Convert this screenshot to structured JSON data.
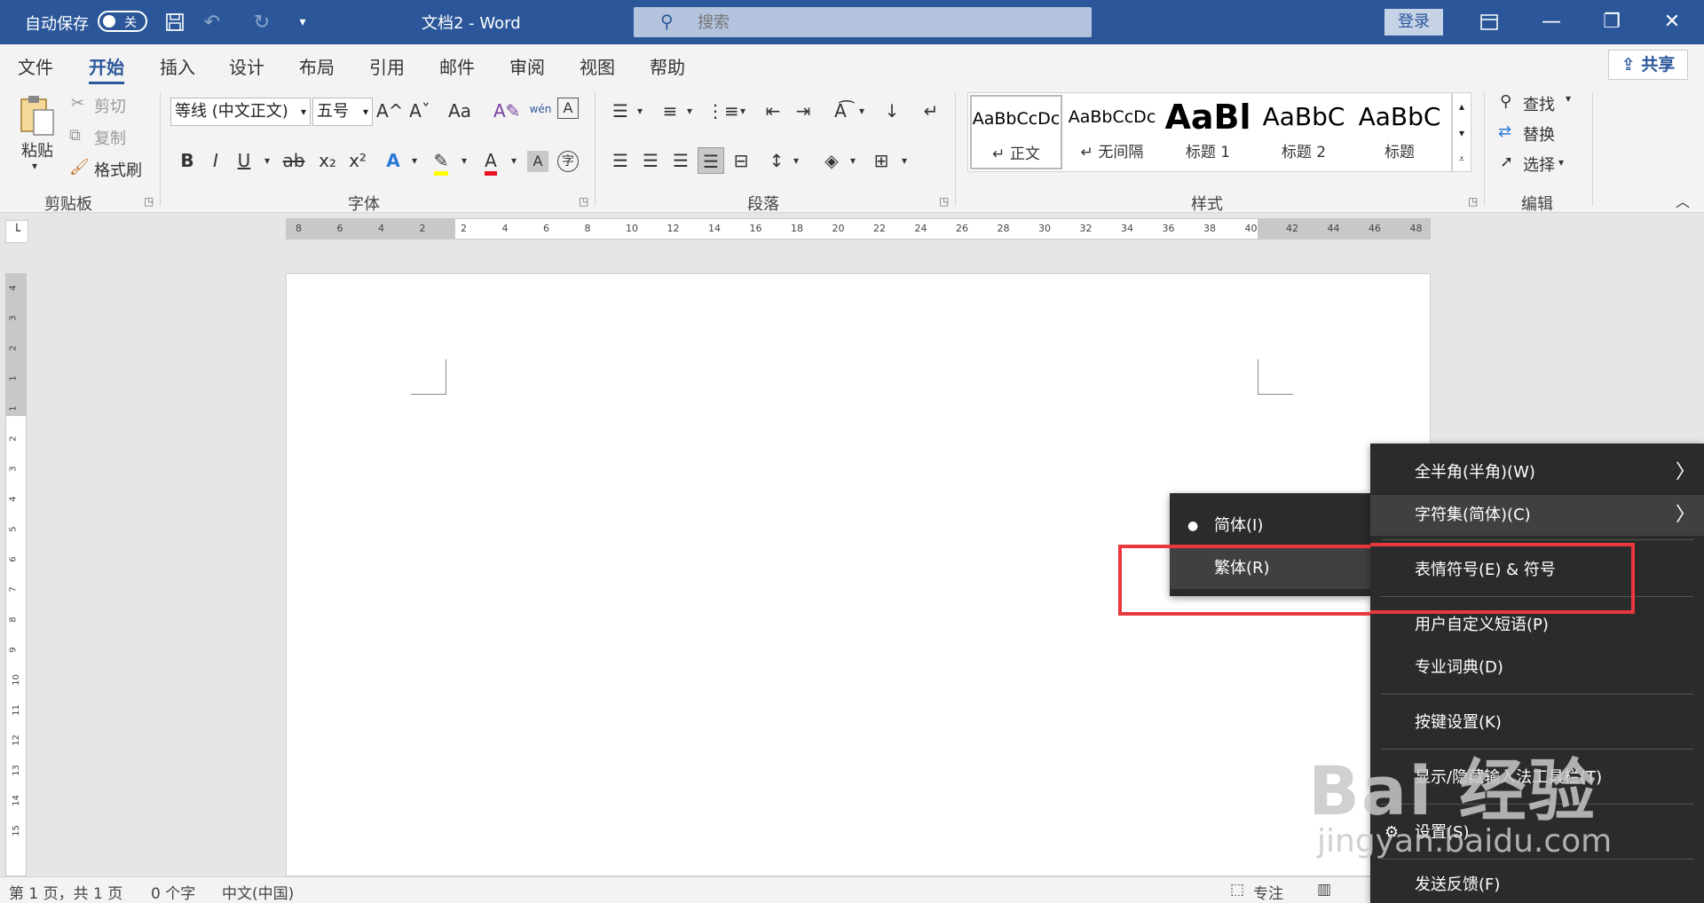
{
  "titlebar": {
    "autosave_label": "自动保存",
    "autosave_state": "关",
    "doc_title": "文档2  -  Word",
    "search_placeholder": "搜索",
    "login_label": "登录"
  },
  "tabs": [
    {
      "label": "文件"
    },
    {
      "label": "开始"
    },
    {
      "label": "插入"
    },
    {
      "label": "设计"
    },
    {
      "label": "布局"
    },
    {
      "label": "引用"
    },
    {
      "label": "邮件"
    },
    {
      "label": "审阅"
    },
    {
      "label": "视图"
    },
    {
      "label": "帮助"
    }
  ],
  "share_label": "共享",
  "clipboard": {
    "paste": "粘贴",
    "cut": "剪切",
    "copy": "复制",
    "format_painter": "格式刷",
    "group": "剪贴板"
  },
  "font": {
    "name": "等线 (中文正文)",
    "size": "五号",
    "group": "字体",
    "grow": "A^",
    "shrink": "Aˇ",
    "change_case": "Aa",
    "phonetic": "wén",
    "bold": "B",
    "italic": "I",
    "underline": "U",
    "strike": "ab",
    "sub": "x₂",
    "sup": "x²",
    "char_border_glyph": "A",
    "enclose_glyph": "字"
  },
  "paragraph": {
    "group": "段落"
  },
  "styles": {
    "group": "样式",
    "items": [
      {
        "sample": "AaBbCcDc",
        "name": "↵ 正文"
      },
      {
        "sample": "AaBbCcDc",
        "name": "↵ 无间隔"
      },
      {
        "sample": "AaBl",
        "name": "标题 1"
      },
      {
        "sample": "AaBbC",
        "name": "标题 2"
      },
      {
        "sample": "AaBbC",
        "name": "标题"
      }
    ]
  },
  "editing": {
    "group": "编辑",
    "find": "查找",
    "replace": "替换",
    "select": "选择"
  },
  "ruler_h": [
    "8",
    "6",
    "4",
    "2",
    "2",
    "4",
    "6",
    "8",
    "10",
    "12",
    "14",
    "16",
    "18",
    "20",
    "22",
    "24",
    "26",
    "28",
    "30",
    "32",
    "34",
    "36",
    "38",
    "40",
    "42",
    "44",
    "46",
    "48"
  ],
  "ruler_v": [
    "4",
    "3",
    "2",
    "1",
    "1",
    "2",
    "3",
    "4",
    "5",
    "6",
    "7",
    "8",
    "9",
    "10",
    "11",
    "12",
    "13",
    "14",
    "15"
  ],
  "statusbar": {
    "page": "第 1 页，共 1 页",
    "words": "0 个字",
    "lang": "中文(中国)",
    "focus": "专注"
  },
  "main_menu": [
    {
      "label": "全半角(半角)(W)"
    },
    {
      "label": "字符集(简体)(C)"
    },
    {
      "label": "表情符号(E) & 符号"
    },
    {
      "label": "用户自定义短语(P)"
    },
    {
      "label": "专业词典(D)"
    },
    {
      "label": "按键设置(K)"
    },
    {
      "label": "显示/隐藏输入法工具栏(T)"
    },
    {
      "label": "设置(S)"
    },
    {
      "label": "发送反馈(F)"
    }
  ],
  "sub_menu": [
    {
      "label": "简体(I)"
    },
    {
      "label": "繁体(R)"
    }
  ],
  "colors": {
    "word_blue": "#2b579a",
    "menu_bg": "#2b2b2b",
    "highlight_red": "#e8383d",
    "highlight_yellow": "#ffff00",
    "font_red": "#e81123"
  },
  "watermark": {
    "big": "Bai 经验",
    "small": "jingyan.baidu.com"
  }
}
